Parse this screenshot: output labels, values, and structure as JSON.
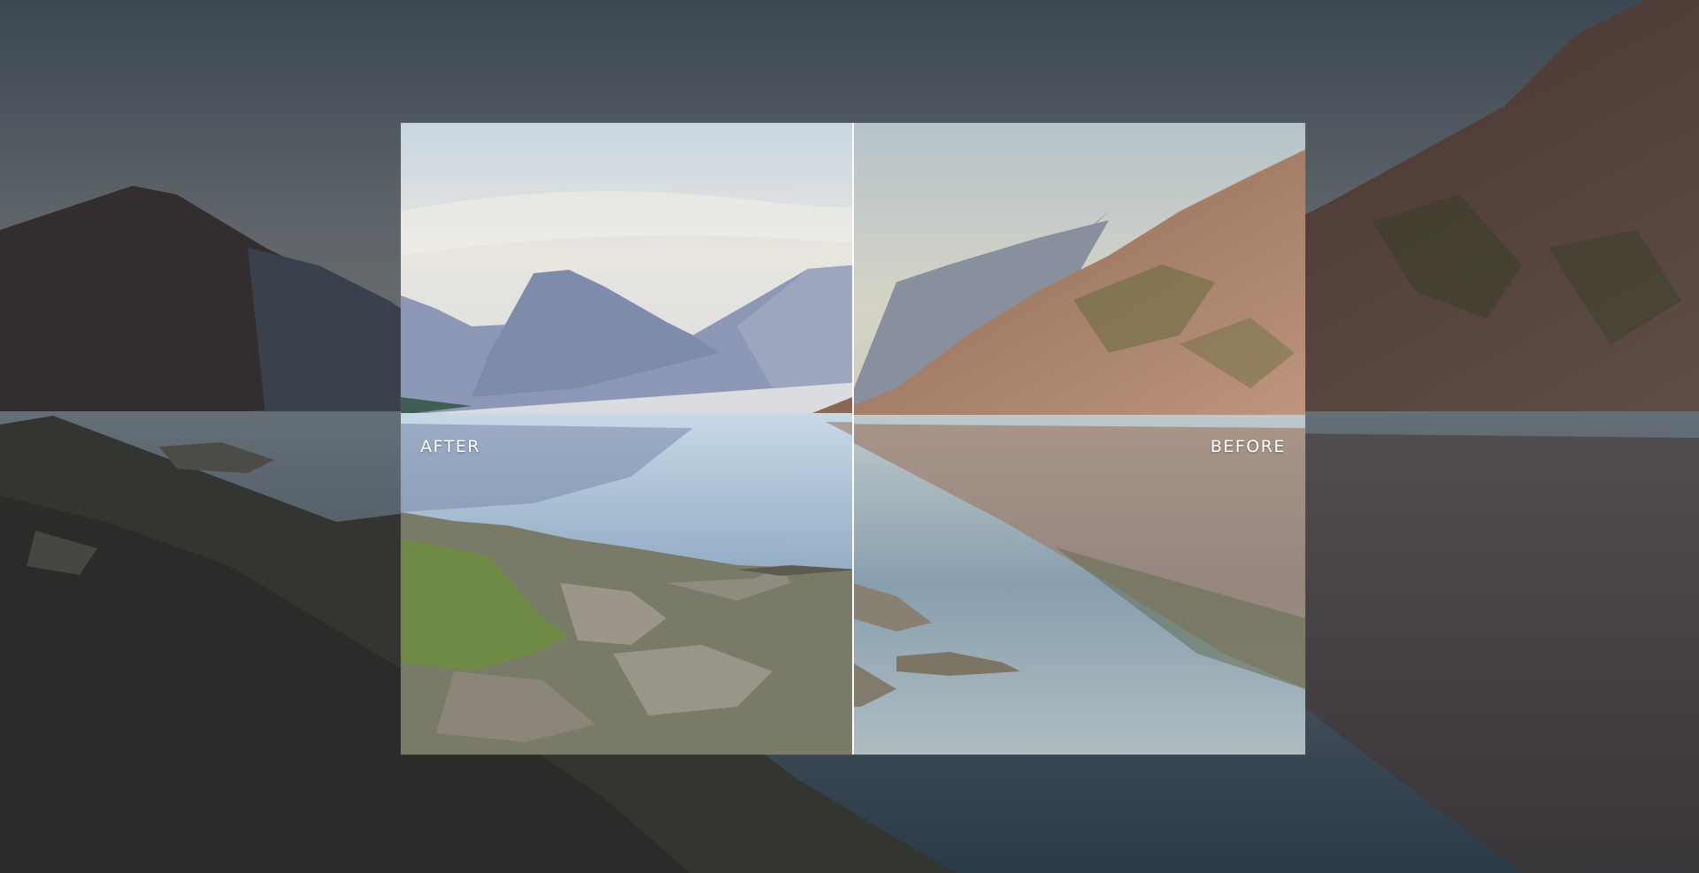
{
  "comparison": {
    "after_label": "AFTER",
    "before_label": "BEFORE",
    "split_fraction": 0.5
  },
  "colors": {
    "divider": "#ffffff",
    "label_text": "#ffffff"
  }
}
